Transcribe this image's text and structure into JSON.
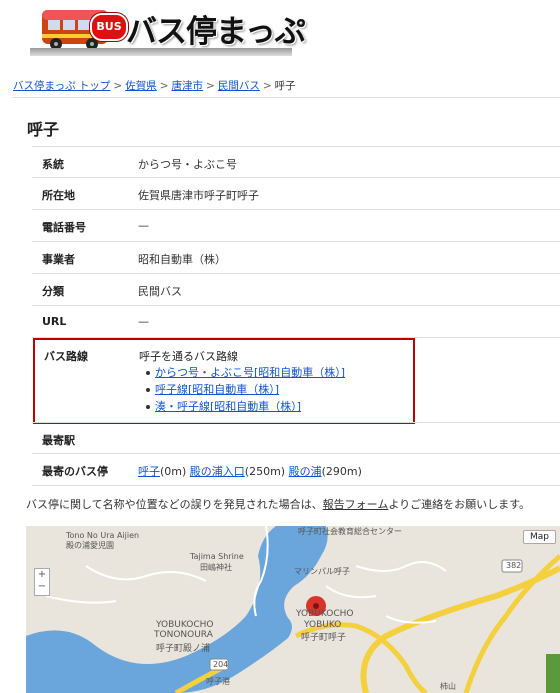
{
  "header": {
    "logo_badge": "BUS",
    "logo_text": "バス停まっぷ"
  },
  "breadcrumb": [
    {
      "label": "バス停まっぷ トップ",
      "link": true
    },
    {
      "label": "佐賀県",
      "link": true
    },
    {
      "label": "唐津市",
      "link": true
    },
    {
      "label": "民間バス",
      "link": true
    },
    {
      "label": "呼子",
      "link": false
    }
  ],
  "breadcrumb_sep": ">",
  "page_title": "呼子",
  "info": {
    "system": {
      "label": "系統",
      "value": "からつ号・よぶこ号"
    },
    "address": {
      "label": "所在地",
      "value": "佐賀県唐津市呼子町呼子"
    },
    "phone": {
      "label": "電話番号",
      "value": "—"
    },
    "operator": {
      "label": "事業者",
      "value": "昭和自動車（株）"
    },
    "category": {
      "label": "分類",
      "value": "民間バス"
    },
    "url": {
      "label": "URL",
      "value": "—"
    },
    "routes": {
      "label": "バス路線",
      "title": "呼子を通るバス路線",
      "items": [
        "からつ号・よぶこ号[昭和自動車（株）]",
        "呼子線[昭和自動車（株）]",
        "湊・呼子線[昭和自動車（株）]"
      ]
    },
    "station": {
      "label": "最寄駅",
      "value": ""
    },
    "nearby": {
      "label": "最寄のバス停",
      "items": [
        {
          "name": "呼子",
          "dist": "(0m)"
        },
        {
          "name": "殿の浦入口",
          "dist": "(250m)"
        },
        {
          "name": "殿の浦",
          "dist": "(290m)"
        }
      ]
    }
  },
  "notice": {
    "before": "バス停に関して名称や位置などの誤りを発見された場合は、",
    "link": "報告フォーム",
    "after": "よりご連絡をお願いします。"
  },
  "map": {
    "map_button": "Map",
    "zoom_in": "+",
    "zoom_out": "−",
    "labels": {
      "tono_ura": "Tono No Ura Aijien",
      "tono_ura_jp": "殿の浦愛児園",
      "tajima": "Tajima Shrine",
      "tajima_jp": "田嶋神社",
      "marina": "マリンパル呼子",
      "hall": "呼子町社会教育総合センター",
      "yobukocho": "YOBUKOCHO",
      "yobuko": "YOBUKO",
      "yobuko_jp": "呼子町呼子",
      "tononoura": "TONONOURA",
      "yobukocho2": "YOBUKOCHO",
      "tononoura_jp": "呼子町殿ノ浦",
      "port": "呼子港",
      "road_382": "382",
      "road_204": "204",
      "kakiyama": "柿山"
    },
    "colors": {
      "water": "#6aa6dc",
      "road": "#f4d03f",
      "pin": "#d9342b"
    }
  }
}
